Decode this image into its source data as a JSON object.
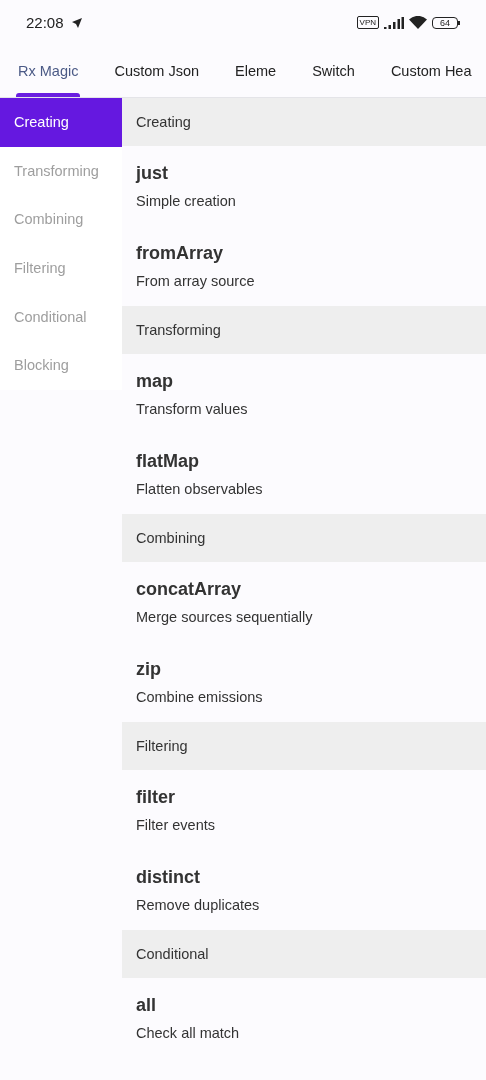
{
  "status_bar": {
    "time": "22:08",
    "vpn": "VPN",
    "battery": "64"
  },
  "tabs": [
    {
      "label": "Rx Magic",
      "selected": true
    },
    {
      "label": "Custom Json",
      "selected": false
    },
    {
      "label": "Eleme",
      "selected": false
    },
    {
      "label": "Switch",
      "selected": false
    },
    {
      "label": "Custom Hea",
      "selected": false
    }
  ],
  "sidebar": {
    "items": [
      {
        "label": "Creating",
        "selected": true
      },
      {
        "label": "Transforming",
        "selected": false
      },
      {
        "label": "Combining",
        "selected": false
      },
      {
        "label": "Filtering",
        "selected": false
      },
      {
        "label": "Conditional",
        "selected": false
      },
      {
        "label": "Blocking",
        "selected": false
      }
    ]
  },
  "sections": [
    {
      "header": "Creating",
      "items": [
        {
          "title": "just",
          "subtitle": "Simple creation"
        },
        {
          "title": "fromArray",
          "subtitle": "From array source"
        }
      ]
    },
    {
      "header": "Transforming",
      "items": [
        {
          "title": "map",
          "subtitle": "Transform values"
        },
        {
          "title": "flatMap",
          "subtitle": "Flatten observables"
        }
      ]
    },
    {
      "header": "Combining",
      "items": [
        {
          "title": "concatArray",
          "subtitle": "Merge sources sequentially"
        },
        {
          "title": "zip",
          "subtitle": "Combine emissions"
        }
      ]
    },
    {
      "header": "Filtering",
      "items": [
        {
          "title": "filter",
          "subtitle": "Filter events"
        },
        {
          "title": "distinct",
          "subtitle": "Remove duplicates"
        }
      ]
    },
    {
      "header": "Conditional",
      "items": [
        {
          "title": "all",
          "subtitle": "Check all match"
        }
      ]
    }
  ]
}
